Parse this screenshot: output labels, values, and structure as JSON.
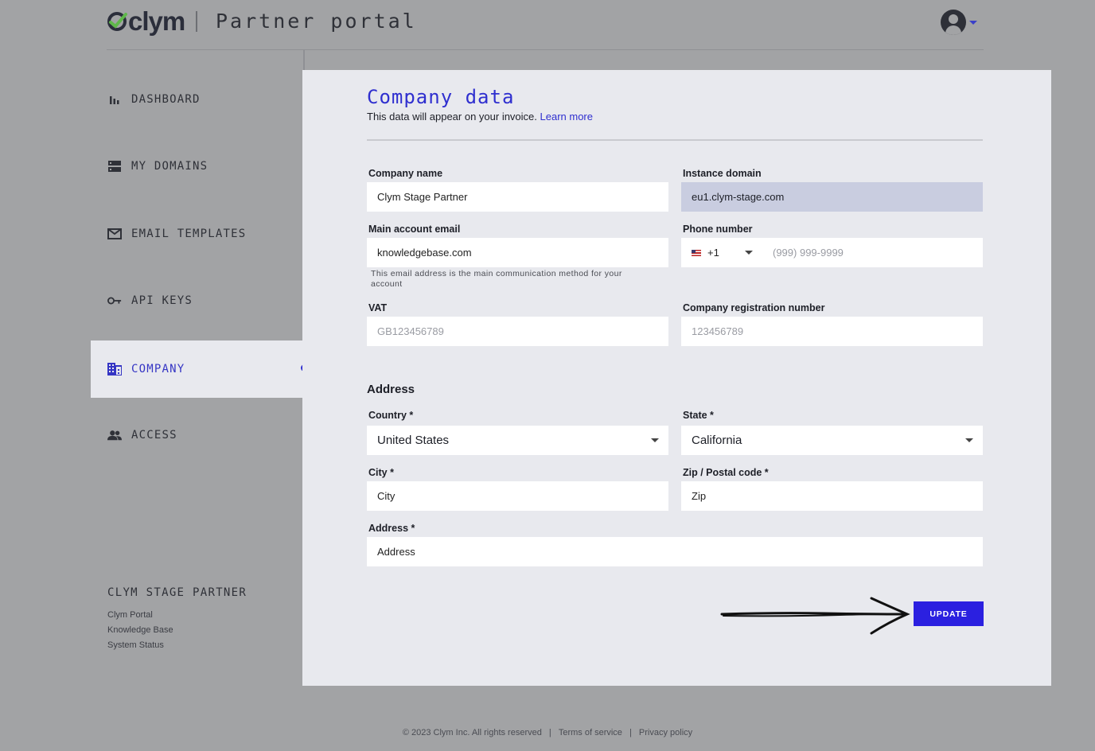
{
  "header": {
    "logo_text": "clym",
    "portal_title": "Partner portal"
  },
  "sidebar": {
    "items": [
      {
        "label": "DASHBOARD",
        "icon": "bar-chart-icon"
      },
      {
        "label": "MY DOMAINS",
        "icon": "server-icon"
      },
      {
        "label": "EMAIL TEMPLATES",
        "icon": "envelope-icon"
      },
      {
        "label": "API KEYS",
        "icon": "key-icon"
      },
      {
        "label": "COMPANY",
        "icon": "building-icon",
        "active": true
      },
      {
        "label": "ACCESS",
        "icon": "people-icon"
      }
    ],
    "org_name": "CLYM STAGE PARTNER",
    "links": [
      "Clym Portal",
      "Knowledge Base",
      "System Status"
    ]
  },
  "page": {
    "title": "Company data",
    "subtitle": "This data will appear on your invoice.",
    "learn_more": "Learn more"
  },
  "form": {
    "company_name": {
      "label": "Company name",
      "value": "Clym Stage Partner"
    },
    "instance_domain": {
      "label": "Instance domain",
      "value": "eu1.clym-stage.com"
    },
    "main_email": {
      "label": "Main account email",
      "value": "knowledgebase.com",
      "hint": "This email address is the main communication method for your account"
    },
    "phone": {
      "label": "Phone number",
      "country_code": "+1",
      "placeholder": "(999) 999-9999"
    },
    "vat": {
      "label": "VAT",
      "placeholder": "GB123456789"
    },
    "registration": {
      "label": "Company registration number",
      "placeholder": "123456789"
    },
    "address_heading": "Address",
    "country": {
      "label": "Country *",
      "value": "United States"
    },
    "state": {
      "label": "State *",
      "value": "California"
    },
    "city": {
      "label": "City *",
      "value": "City"
    },
    "zip": {
      "label": "Zip / Postal code *",
      "value": "Zip"
    },
    "address": {
      "label": "Address *",
      "value": "Address"
    },
    "submit_label": "UPDATE"
  },
  "footer": {
    "copyright": "© 2023 Clym Inc. All rights reserved",
    "sep": "|",
    "terms": "Terms of service",
    "privacy": "Privacy policy"
  },
  "colors": {
    "accent": "#2f2fcf",
    "button": "#2b20e0",
    "background": "#a2a3a5",
    "panel": "#e8e9ee"
  }
}
